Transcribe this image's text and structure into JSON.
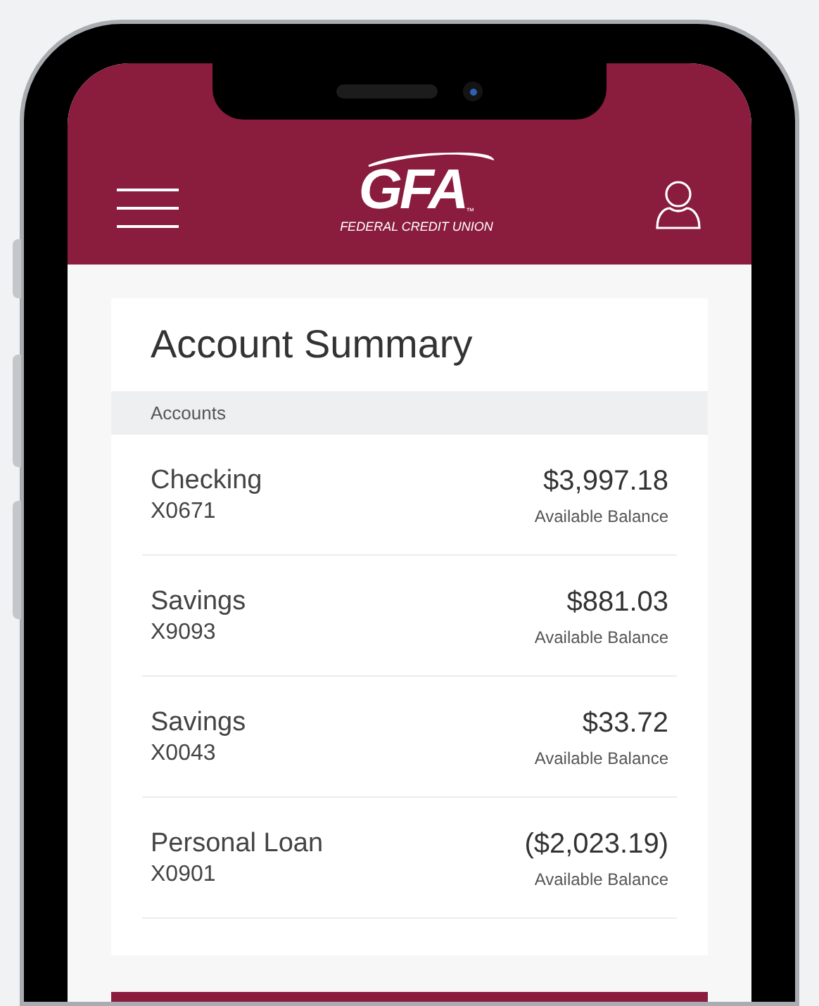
{
  "header": {
    "logo": {
      "text": "GFA",
      "trademark": "™",
      "subtitle": "FEDERAL CREDIT UNION"
    }
  },
  "card": {
    "title": "Account Summary",
    "section": "Accounts",
    "accounts": [
      {
        "name": "Checking",
        "number": "X0671",
        "amount": "$3,997.18",
        "amount_label": "Available Balance"
      },
      {
        "name": "Savings",
        "number": "X9093",
        "amount": "$881.03",
        "amount_label": "Available Balance"
      },
      {
        "name": "Savings",
        "number": "X0043",
        "amount": "$33.72",
        "amount_label": "Available Balance"
      },
      {
        "name": "Personal Loan",
        "number": "X0901",
        "amount": "($2,023.19)",
        "amount_label": "Available Balance"
      }
    ]
  }
}
